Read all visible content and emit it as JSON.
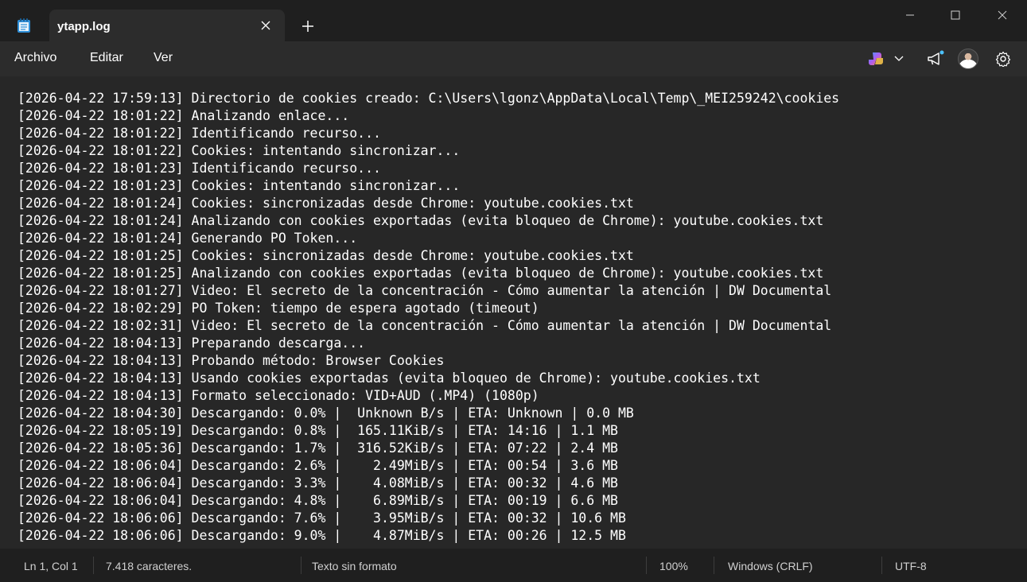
{
  "window": {
    "tab_title": "ytapp.log"
  },
  "menu": {
    "items": [
      "Archivo",
      "Editar",
      "Ver"
    ]
  },
  "icons": {
    "app": "notepad-icon",
    "close_tab": "close-icon",
    "new_tab": "plus-icon",
    "copilot": "copilot-icon",
    "chevron": "chevron-down-icon",
    "announce": "megaphone-icon",
    "settings": "gear-icon"
  },
  "colors": {
    "background": "#272727",
    "titlebar": "#1f1f1f",
    "text": "#ffffff"
  },
  "editor": {
    "lines": [
      "[2026-04-22 17:59:13] Directorio de cookies creado: C:\\Users\\lgonz\\AppData\\Local\\Temp\\_MEI259242\\cookies",
      "[2026-04-22 18:01:22] Analizando enlace...",
      "[2026-04-22 18:01:22] Identificando recurso...",
      "[2026-04-22 18:01:22] Cookies: intentando sincronizar...",
      "[2026-04-22 18:01:23] Identificando recurso...",
      "[2026-04-22 18:01:23] Cookies: intentando sincronizar...",
      "[2026-04-22 18:01:24] Cookies: sincronizadas desde Chrome: youtube.cookies.txt",
      "[2026-04-22 18:01:24] Analizando con cookies exportadas (evita bloqueo de Chrome): youtube.cookies.txt",
      "[2026-04-22 18:01:24] Generando PO Token...",
      "[2026-04-22 18:01:25] Cookies: sincronizadas desde Chrome: youtube.cookies.txt",
      "[2026-04-22 18:01:25] Analizando con cookies exportadas (evita bloqueo de Chrome): youtube.cookies.txt",
      "[2026-04-22 18:01:27] Video: El secreto de la concentración - Cómo aumentar la atención | DW Documental",
      "[2026-04-22 18:02:29] PO Token: tiempo de espera agotado (timeout)",
      "[2026-04-22 18:02:31] Video: El secreto de la concentración - Cómo aumentar la atención | DW Documental",
      "[2026-04-22 18:04:13] Preparando descarga...",
      "[2026-04-22 18:04:13] Probando método: Browser Cookies",
      "[2026-04-22 18:04:13] Usando cookies exportadas (evita bloqueo de Chrome): youtube.cookies.txt",
      "[2026-04-22 18:04:13] Formato seleccionado: VID+AUD (.MP4) (1080p)",
      "[2026-04-22 18:04:30] Descargando: 0.0% |  Unknown B/s | ETA: Unknown | 0.0 MB",
      "[2026-04-22 18:05:19] Descargando: 0.8% |  165.11KiB/s | ETA: 14:16 | 1.1 MB",
      "[2026-04-22 18:05:36] Descargando: 1.7% |  316.52KiB/s | ETA: 07:22 | 2.4 MB",
      "[2026-04-22 18:06:04] Descargando: 2.6% |    2.49MiB/s | ETA: 00:54 | 3.6 MB",
      "[2026-04-22 18:06:04] Descargando: 3.3% |    4.08MiB/s | ETA: 00:32 | 4.6 MB",
      "[2026-04-22 18:06:04] Descargando: 4.8% |    6.89MiB/s | ETA: 00:19 | 6.6 MB",
      "[2026-04-22 18:06:06] Descargando: 7.6% |    3.95MiB/s | ETA: 00:32 | 10.6 MB",
      "[2026-04-22 18:06:06] Descargando: 9.0% |    4.87MiB/s | ETA: 00:26 | 12.5 MB"
    ]
  },
  "status": {
    "position": "Ln 1, Col 1",
    "characters": "7.418 caracteres.",
    "format": "Texto sin formato",
    "zoom": "100%",
    "line_ending": "Windows (CRLF)",
    "encoding": "UTF-8"
  }
}
